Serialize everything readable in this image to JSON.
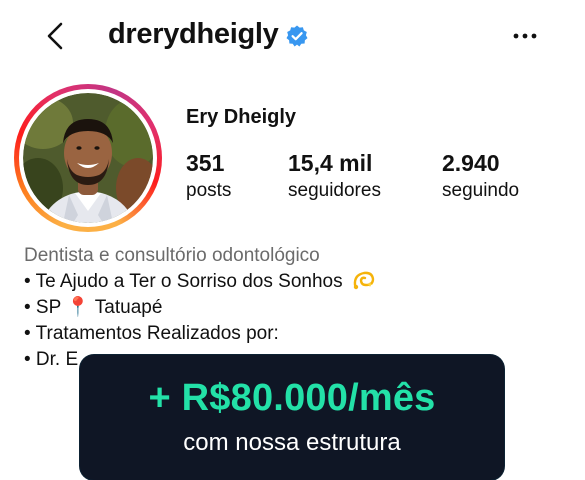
{
  "header": {
    "username": "drerydheigly",
    "back_icon": "chevron-left-icon",
    "verified_icon": "verified-badge-icon",
    "more_icon": "more-horizontal-icon"
  },
  "profile": {
    "display_name": "Ery Dheigly",
    "stats": [
      {
        "value": "351",
        "label": "posts"
      },
      {
        "value": "15,4 mil",
        "label": "seguidores"
      },
      {
        "value": "2.940",
        "label": "seguindo"
      }
    ]
  },
  "bio": {
    "category": "Dentista e consultório odontológico",
    "lines": [
      {
        "text": "• Te Ajudo a Ter o Sorriso dos Sonhos",
        "emoji": "dizzy-icon"
      },
      {
        "text": "• SP 📍 Tatuapé"
      },
      {
        "text": "• Tratamentos Realizados por:"
      },
      {
        "text": "• Dr. E"
      }
    ]
  },
  "promo": {
    "headline": "+ R$80.000/mês",
    "subtext": "com nossa estrutura"
  },
  "colors": {
    "verified_blue": "#3897f0",
    "promo_bg": "#0f1625",
    "promo_accent": "#23e1a8"
  }
}
